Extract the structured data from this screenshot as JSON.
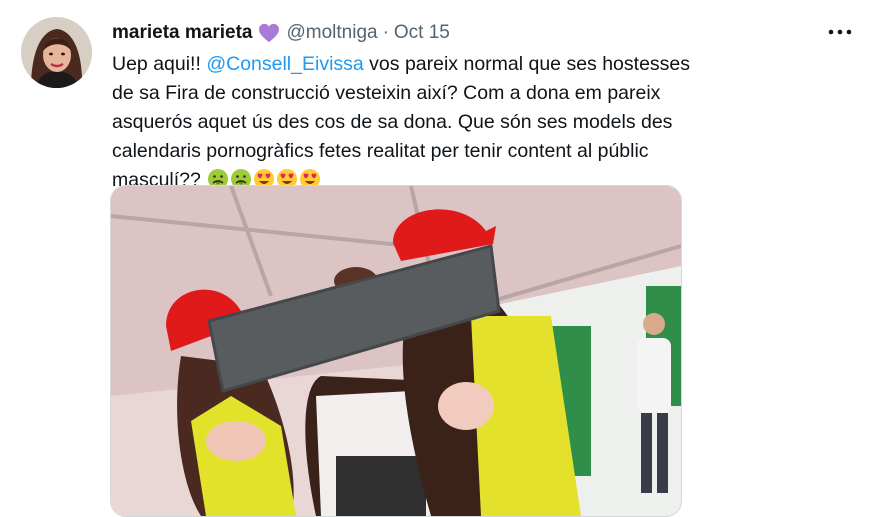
{
  "tweet": {
    "display_name": "marieta marieta",
    "handle": "@moltniga",
    "separator": "·",
    "date": "Oct 15",
    "text_before_mention": "Uep aqui!! ",
    "mention": "@Consell_Eivissa",
    "text_after_mention": " vos pareix normal que ses hostesses de sa Fira de construcció vesteixin així? Com a dona em pareix asquerós aquet ús des cos de sa dona. Que són ses models des calendaris pornogràfics fetes realitat per tenir content al públic masculí?? ",
    "emojis": [
      "nauseated-face-emoji",
      "nauseated-face-emoji",
      "heart-eyes-emoji",
      "heart-eyes-emoji",
      "heart-eyes-emoji"
    ]
  },
  "icons": {
    "verified_badge": "purple-heart-icon",
    "menu": "more-dots-icon"
  },
  "colors": {
    "link": "#1d9bf0",
    "muted": "#536471",
    "heart": "#a87bd6"
  }
}
